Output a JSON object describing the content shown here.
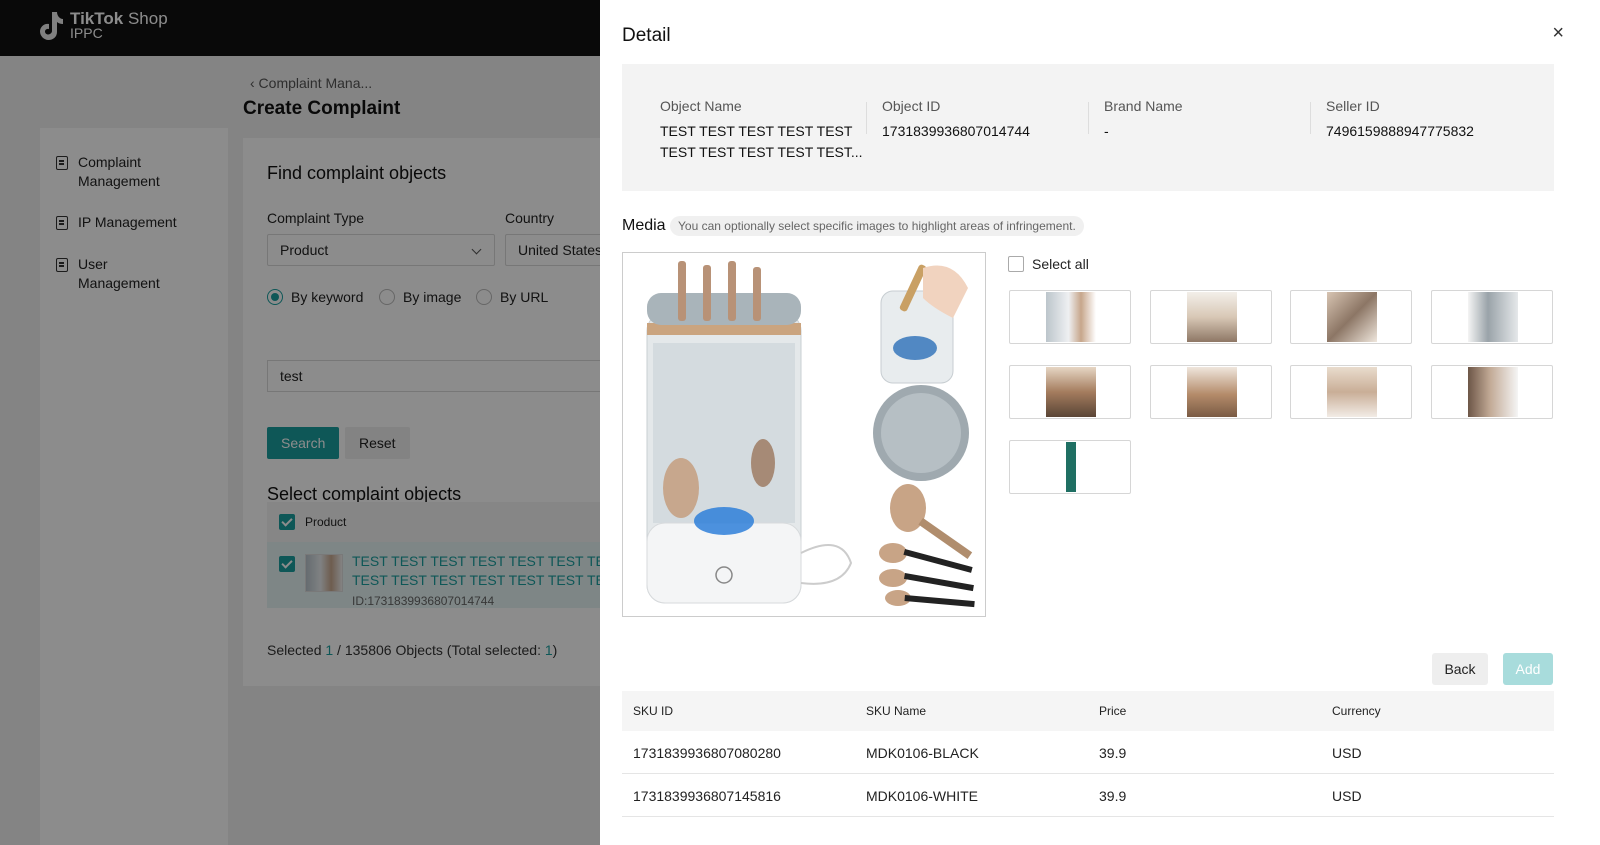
{
  "app": {
    "brand_bold": "TikTok",
    "brand_shop": " Shop",
    "brand_sub": "IPPC"
  },
  "page": {
    "breadcrumb": "‹ Complaint Mana...",
    "title": "Create Complaint",
    "nav": [
      {
        "label_line1": "Complaint",
        "label_line2": "Management"
      },
      {
        "label_line1": "IP Management",
        "label_line2": ""
      },
      {
        "label_line1": "User",
        "label_line2": "Management"
      }
    ],
    "find": {
      "heading": "Find complaint objects",
      "complaint_type_label": "Complaint Type",
      "complaint_type_value": "Product",
      "country_label": "Country",
      "country_value": "United States",
      "radio": [
        "By keyword",
        "By image",
        "By URL"
      ],
      "keyword_value": "test",
      "search_label": "Search",
      "reset_label": "Reset"
    },
    "select": {
      "heading": "Select complaint objects",
      "column_product": "Product",
      "row_line1": "TEST TEST TEST TEST TEST TEST TEST",
      "row_line2": "TEST TEST TEST TEST TEST TEST TES...",
      "row_id": "ID:1731839936807014744",
      "selected_prefix": "Selected ",
      "selected_count": "1",
      "selected_mid": " / 135806 Objects (Total selected: ",
      "selected_total": "1",
      "selected_suffix": ")"
    }
  },
  "drawer": {
    "title": "Detail",
    "close": "×",
    "info": {
      "object_name_label": "Object Name",
      "object_name_line1": "TEST TEST TEST TEST TEST",
      "object_name_line2": "TEST TEST TEST TEST TEST...",
      "object_id_label": "Object ID",
      "object_id": "1731839936807014744",
      "brand_label": "Brand Name",
      "brand": "-",
      "seller_label": "Seller ID",
      "seller": "7496159888947775832"
    },
    "media_label": "Media",
    "media_hint": "You can optionally select specific images to highlight areas of infringement.",
    "select_all": "Select all",
    "back_label": "Back",
    "add_label": "Add",
    "sku_columns": [
      "SKU ID",
      "SKU Name",
      "Price",
      "Currency"
    ],
    "sku_rows": [
      {
        "id": "1731839936807080280",
        "name": "MDK0106-BLACK",
        "price": "39.9",
        "currency": "USD"
      },
      {
        "id": "1731839936807145816",
        "name": "MDK0106-WHITE",
        "price": "39.9",
        "currency": "USD"
      }
    ]
  },
  "colors": {
    "accent": "#1a9e9e",
    "topbar": "#111111",
    "add_disabled": "#a8dcdc"
  }
}
